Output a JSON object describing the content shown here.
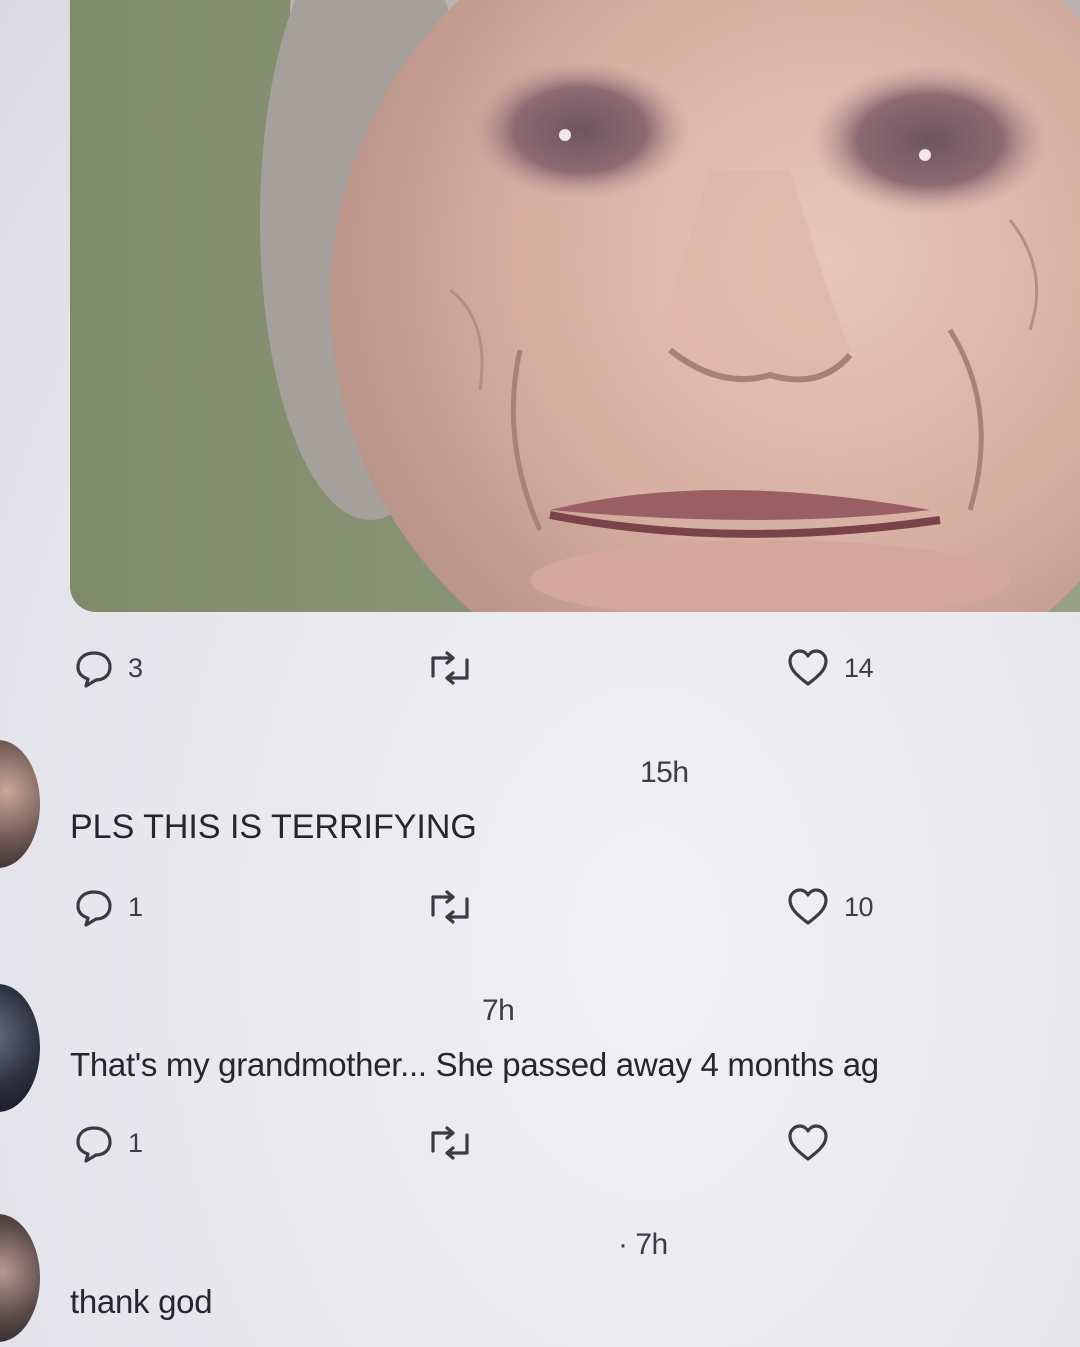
{
  "post": {
    "image_icon": "photo-elderly-woman",
    "reply_count": "3",
    "like_count": "14"
  },
  "comments": [
    {
      "timestamp": "15h",
      "text": "PLS THIS IS TERRIFYING",
      "reply_count": "1",
      "like_count": "10"
    },
    {
      "timestamp": "7h",
      "text": "That's my grandmother... She passed away 4 months ag",
      "reply_count": "1",
      "like_count": ""
    },
    {
      "timestamp": "· 7h",
      "text": "thank god"
    }
  ],
  "icons": {
    "reply": "speech-bubble-icon",
    "retweet": "retweet-icon",
    "like": "heart-icon"
  },
  "colors": {
    "icon_stroke": "#3b3b45",
    "text": "#26262f",
    "background": "#e9e9ee"
  }
}
